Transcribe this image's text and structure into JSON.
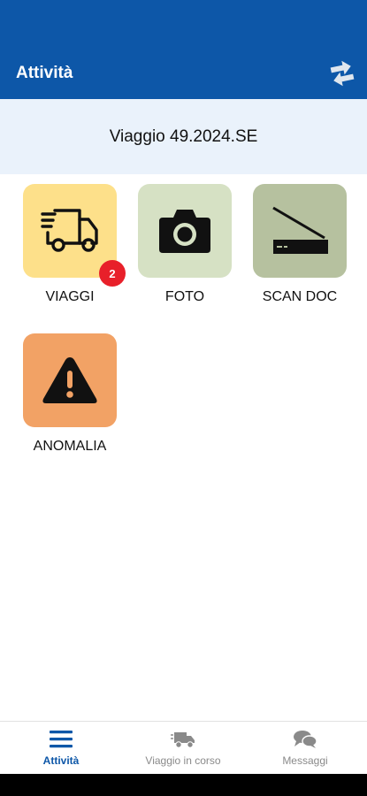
{
  "appbar": {
    "title": "Attività",
    "sync_icon": "swap-arrows-icon",
    "color": "#0d57a8"
  },
  "trip": {
    "label": "Viaggio 49.2024.SE"
  },
  "tiles": [
    {
      "label": "VIAGGI",
      "icon": "truck-icon",
      "color": "#fde08a",
      "badge": "2"
    },
    {
      "label": "FOTO",
      "icon": "camera-icon",
      "color": "#d6e1c4"
    },
    {
      "label": "SCAN DOC",
      "icon": "scanner-icon",
      "color": "#b6c19f"
    },
    {
      "label": "ANOMALIA",
      "icon": "warning-icon",
      "color": "#f2a265"
    }
  ],
  "nav": [
    {
      "label": "Attività",
      "icon": "menu-icon",
      "active": true
    },
    {
      "label": "Viaggio in corso",
      "icon": "delivery-truck-icon",
      "active": false
    },
    {
      "label": "Messaggi",
      "icon": "chat-bubbles-icon",
      "active": false
    }
  ]
}
